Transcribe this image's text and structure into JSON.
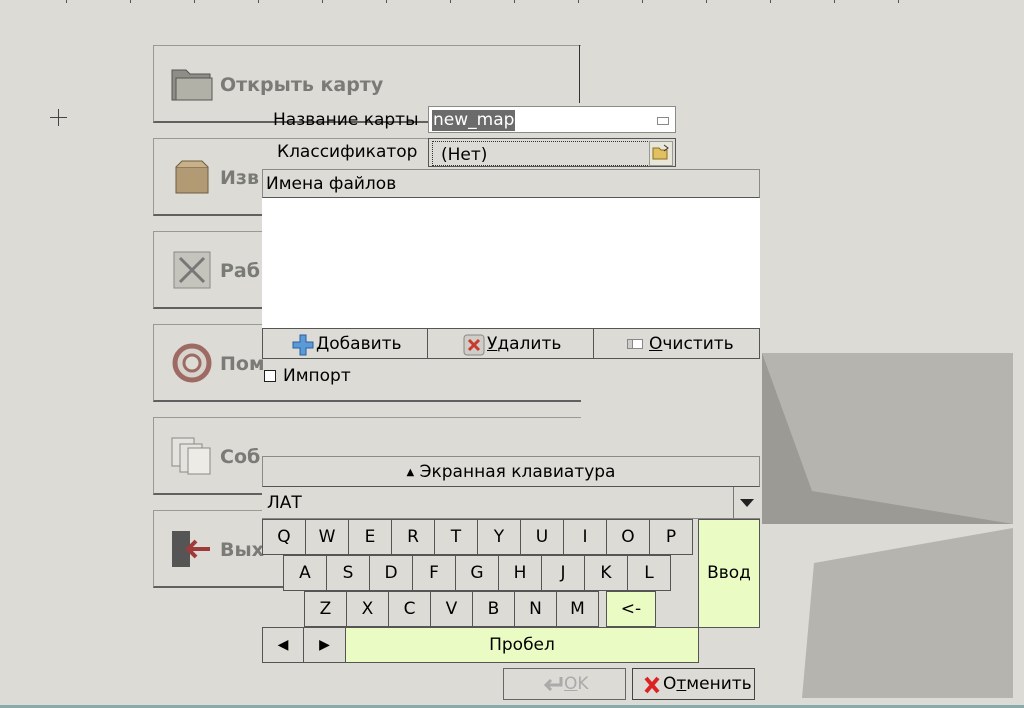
{
  "menu": [
    {
      "label": "Открыть карту",
      "icon": "folder-icon"
    },
    {
      "label": "Изв",
      "icon": "box-icon"
    },
    {
      "label": "Раб",
      "icon": "cross-icon"
    },
    {
      "label": "Пом",
      "icon": "lifebuoy-icon"
    },
    {
      "label": "Соб",
      "icon": "documents-icon"
    },
    {
      "label": "Вых",
      "icon": "exit-icon"
    }
  ],
  "form": {
    "map_name_label": "Название карты",
    "map_name_value": "new_map",
    "classifier_label": "Классификатор",
    "classifier_value": "(Нет)"
  },
  "files": {
    "header": "Имена файлов",
    "add_first": "Д",
    "add_rest": "обавить",
    "delete_first": "У",
    "delete_rest": "далить",
    "clear_first": "О",
    "clear_rest": "чистить"
  },
  "import_label": "Импорт",
  "keyboard": {
    "title": "Экранная клавиатура",
    "language": "ЛАТ",
    "row1": [
      "Q",
      "W",
      "E",
      "R",
      "T",
      "Y",
      "U",
      "I",
      "O",
      "P"
    ],
    "row2": [
      "A",
      "S",
      "D",
      "F",
      "G",
      "H",
      "J",
      "K",
      "L"
    ],
    "row3": [
      "Z",
      "X",
      "C",
      "V",
      "B",
      "N",
      "M"
    ],
    "backspace": "<-",
    "enter": "Ввод",
    "space": "Пробел",
    "left_arrow": "◀",
    "right_arrow": "▶"
  },
  "dialog": {
    "ok_first": "O",
    "ok_rest": "K",
    "cancel_first": "О",
    "cancel_mid": "т",
    "cancel_rest": "менить"
  },
  "colors": {
    "accent_green": "#eafbc3",
    "background": "#dcdbd5"
  }
}
